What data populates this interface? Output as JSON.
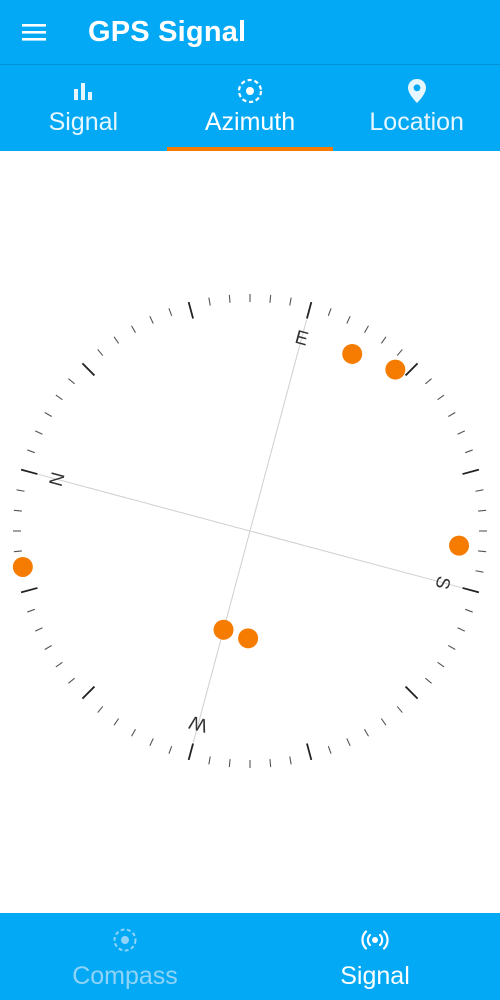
{
  "app": {
    "title": "GPS Signal"
  },
  "tabs": [
    {
      "label": "Signal",
      "icon": "bar-chart-icon"
    },
    {
      "label": "Azimuth",
      "icon": "azimuth-icon",
      "active": true
    },
    {
      "label": "Location",
      "icon": "location-pin-icon"
    }
  ],
  "compass": {
    "labels": {
      "north": "N",
      "east": "E",
      "south": "S",
      "west": "W"
    },
    "north_bearing_on_screen_deg": -75,
    "satellites": [
      {
        "azimuth_deg": 105,
        "elevation_deg": 10
      },
      {
        "azimuth_deg": 117,
        "elevation_deg": 5
      },
      {
        "azimuth_deg": 169,
        "elevation_deg": 8
      },
      {
        "azimuth_deg": 270,
        "elevation_deg": 50
      },
      {
        "azimuth_deg": 256,
        "elevation_deg": 48
      },
      {
        "azimuth_deg": 336,
        "elevation_deg": 0
      }
    ]
  },
  "bottom_nav": [
    {
      "label": "Compass",
      "icon": "compass-icon",
      "active": false
    },
    {
      "label": "Signal",
      "icon": "signal-broadcast-icon",
      "active": true
    }
  ],
  "colors": {
    "primary": "#03a9f4",
    "accent": "#f57c00",
    "satellite": "#f57c00"
  }
}
